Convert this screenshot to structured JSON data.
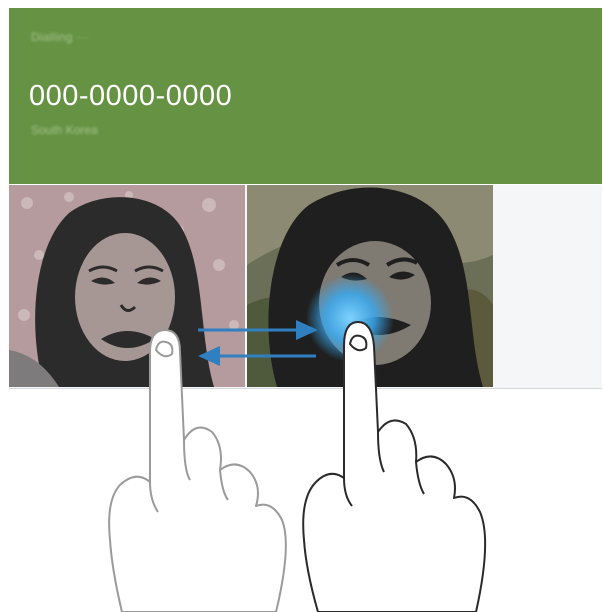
{
  "header": {
    "status_label": "Dialling ···",
    "phone_number": "000-0000-0000",
    "location": "South Korea"
  },
  "colors": {
    "header_background": "#659243",
    "swap_arrows": "#2f7fc1",
    "touch_glow": "#39a9f0"
  },
  "gesture": {
    "type": "drag-to-swap-video-feeds",
    "icons": [
      "hand-pointer-icon",
      "hand-pointer-icon"
    ],
    "arrows": [
      "arrow-right-icon",
      "arrow-left-icon"
    ]
  }
}
